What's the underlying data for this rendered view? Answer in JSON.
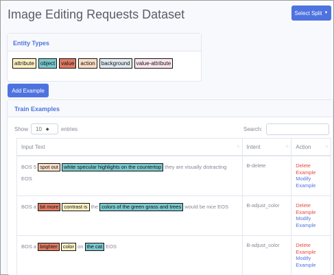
{
  "header": {
    "title": "Image Editing Requests Dataset",
    "split_button": "Select Split"
  },
  "entity_types": {
    "title": "Entity Types",
    "tags": [
      {
        "label": "attribute",
        "color": "#fff3c4"
      },
      {
        "label": "object",
        "color": "#7cc9cf"
      },
      {
        "label": "value",
        "color": "#e07b64"
      },
      {
        "label": "action",
        "color": "#fbdfc8"
      },
      {
        "label": "background",
        "color": "#e3ebf2"
      },
      {
        "label": "value-attribute",
        "color": "#fbe7ee"
      }
    ]
  },
  "add_button": "Add Example",
  "train": {
    "title": "Train Examples",
    "show_label": "Show",
    "entries_value": "10",
    "entries_label": "entries",
    "search_label": "Search:",
    "columns": [
      "Input Text",
      "Intent",
      "Action"
    ],
    "rows": [
      {
        "seg": {
          "t0": "BOS 5",
          "e1": "spot out",
          "e2": "white specular highlights on the countertop",
          "t3": "they are visually distracting EOS"
        },
        "intent": "B-delete",
        "delete": "Delete Example",
        "modify": "Modify Example"
      },
      {
        "seg": {
          "t0": "BOS a",
          "e1": "bit more",
          "e2": "contrast is",
          "t3": "the",
          "e4": "colors of the green grass and trees",
          "t5": "would be nice EOS"
        },
        "intent": "B-adjust_color",
        "delete": "Delete Example",
        "modify": "Modify Example"
      },
      {
        "seg": {
          "t0": "BOS a",
          "e1": "brighter",
          "e2": "color",
          "t3": "on",
          "e4": "the cat",
          "t5": "EOS"
        },
        "intent": "B-adjust_color",
        "delete": "Delete Example",
        "modify": "Modify Example"
      }
    ]
  },
  "colors": {
    "primary": "#4e73df",
    "danger": "#e74a3b",
    "page_bg": "#f8f9fc"
  }
}
